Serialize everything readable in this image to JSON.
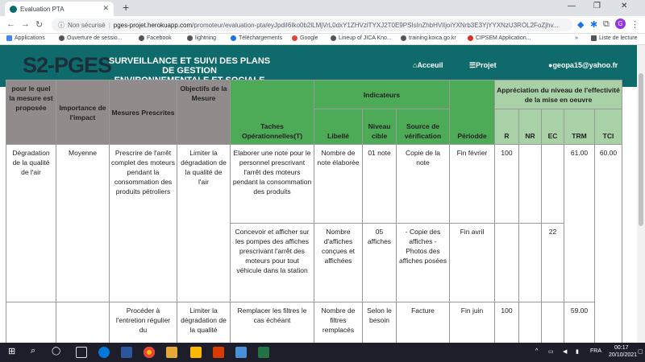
{
  "browser": {
    "tab_title": "Evaluation PTA",
    "url_prefix": "Non sécurisé",
    "url_domain": "pges-projet.herokuapp.com",
    "url_path": "/promoteur/evaluation-pta/eyJpdiI6Iko0b2lLMjVrL0dxY1ZHVzlTYXJ2T0E9PSIsInZhbHVlIjoiYXNrb3E3YjYYXNzU3ROL2FoZjhv...",
    "bookmarks": [
      "Applications",
      "Ouverture de sessio...",
      "Facebook",
      "lightning",
      "Téléchargements",
      "Google",
      "Lineup of JICA Kno...",
      "training.koica.go.kr",
      "CIPSEM Application..."
    ],
    "reading_list": "Liste de lecture"
  },
  "header": {
    "logo": "S2-PGES",
    "title_line1": "SURVEILLANCE ET SUIVI DES PLANS DE GESTION",
    "title_line2": "ENVIRONNEMENTALE ET SOCIALE",
    "nav_home": "Acceuil",
    "nav_projet": "Projet",
    "user_email": "geopa15@yahoo.fr"
  },
  "table": {
    "col_pour": "pour le quel la mesure est proposée",
    "col_importance": "Importance de l'impact",
    "col_mesures": "Mesures Prescrites",
    "col_objectifs": "Objectifs de la Mesure",
    "col_taches": "Taches Opérationnelles(T)",
    "col_indicateurs": "Indicateurs",
    "col_libelle": "Libellé",
    "col_niveau": "Niveau cible",
    "col_source": "Source de vérification",
    "col_periode": "Périodde",
    "col_appreciation": "Appréciation du niveau de l'effectivité de la mise en oeuvre",
    "col_r": "R",
    "col_nr": "NR",
    "col_ec": "EC",
    "col_trm": "TRM",
    "col_tci": "TCI",
    "rows": [
      {
        "impact": "Dégradation de la qualité de l'air",
        "importance": "Moyenne",
        "mesure": "Prescrire de l'arrêt complet des moteurs pendant la consommation des produits pétroliers",
        "objectif": "Limiter la dégradation de la qualité de l'air",
        "tache": "Elaborer une note pour le personnel prescrivant l'arrêt des moteurs pendant la consommation des produits",
        "libelle": "Nombre de note élaborée",
        "niveau": "01 note",
        "source": "Copie de la note",
        "periode": "Fin février",
        "r": "100",
        "nr": "",
        "ec": "",
        "trm": "61.00",
        "tci": "60.00"
      },
      {
        "tache": "Concevoir et afficher sur les pompes des affiches prescrivant l'arrêt des moteurs pour tout véhicule dans la station",
        "libelle": "Nombre d'affiches conçues et affichées",
        "niveau": "05 affiches",
        "source": "- Copie des affiches - Photos des affiches posées",
        "periode": "Fin avril",
        "r": "",
        "nr": "",
        "ec": "22"
      },
      {
        "mesure": "Procéder à l'entretion régulier du",
        "objectif": "Limiter la dégradation de la qualité",
        "tache": "Remplacer les filtres le cas échéant",
        "libelle": "Nombre de filtres remplacés",
        "niveau": "Selon le besoin",
        "source": "Facture",
        "periode": "Fin juin",
        "r": "100",
        "nr": "",
        "ec": "",
        "trm": "59.00"
      }
    ]
  },
  "taskbar": {
    "lang": "FRA",
    "time": "00:17",
    "date": "20/10/2021"
  }
}
